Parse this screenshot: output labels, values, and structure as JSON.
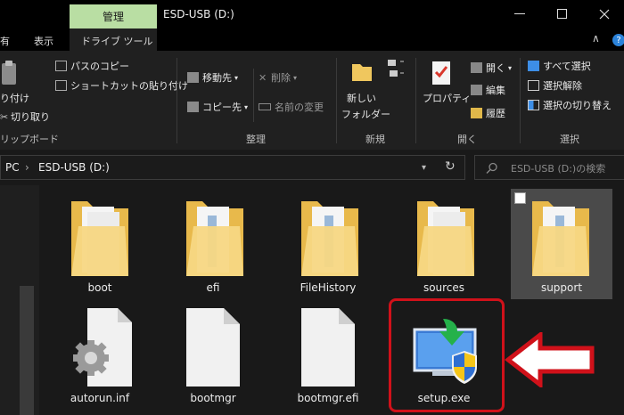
{
  "window": {
    "manage_tab": "管理",
    "title": "ESD-USB (D:)"
  },
  "ribbon_tabs": {
    "share_partial": "有",
    "view": "表示",
    "drive_tools": "ドライブ ツール",
    "chevron": "∧"
  },
  "clipboard": {
    "copy_path": "パスのコピー",
    "paste_shortcut": "ショートカットの貼り付け",
    "paste_partial": "り付け",
    "cut": "切り取り",
    "group_label": "リップボード"
  },
  "organize": {
    "move_to": "移動先",
    "copy_to": "コピー先",
    "delete": "削除",
    "rename": "名前の変更",
    "group_label": "整理"
  },
  "new_group": {
    "new_folder_line1": "新しい",
    "new_folder_line2": "フォルダー",
    "group_label": "新規"
  },
  "open_group": {
    "properties": "プロパティ",
    "open": "開く",
    "edit": "編集",
    "history": "履歴",
    "group_label": "開く"
  },
  "select_group": {
    "select_all": "すべて選択",
    "select_none": "選択解除",
    "invert": "選択の切り替え",
    "group_label": "選択"
  },
  "address": {
    "pc": "PC",
    "separator": "›",
    "drive": "ESD-USB (D:)",
    "refresh": "↻"
  },
  "search": {
    "placeholder": "ESD-USB (D:)の検索"
  },
  "files": {
    "boot": "boot",
    "efi": "efi",
    "filehistory": "FileHistory",
    "sources": "sources",
    "support": "support",
    "autorun": "autorun.inf",
    "bootmgr": "bootmgr",
    "bootmgr_efi": "bootmgr.efi",
    "setup": "setup.exe"
  },
  "colors": {
    "manage_tab": "#b9dea3",
    "folder": "#f3d27a",
    "highlight": "#d0111a",
    "selection": "#4a4a4a"
  }
}
